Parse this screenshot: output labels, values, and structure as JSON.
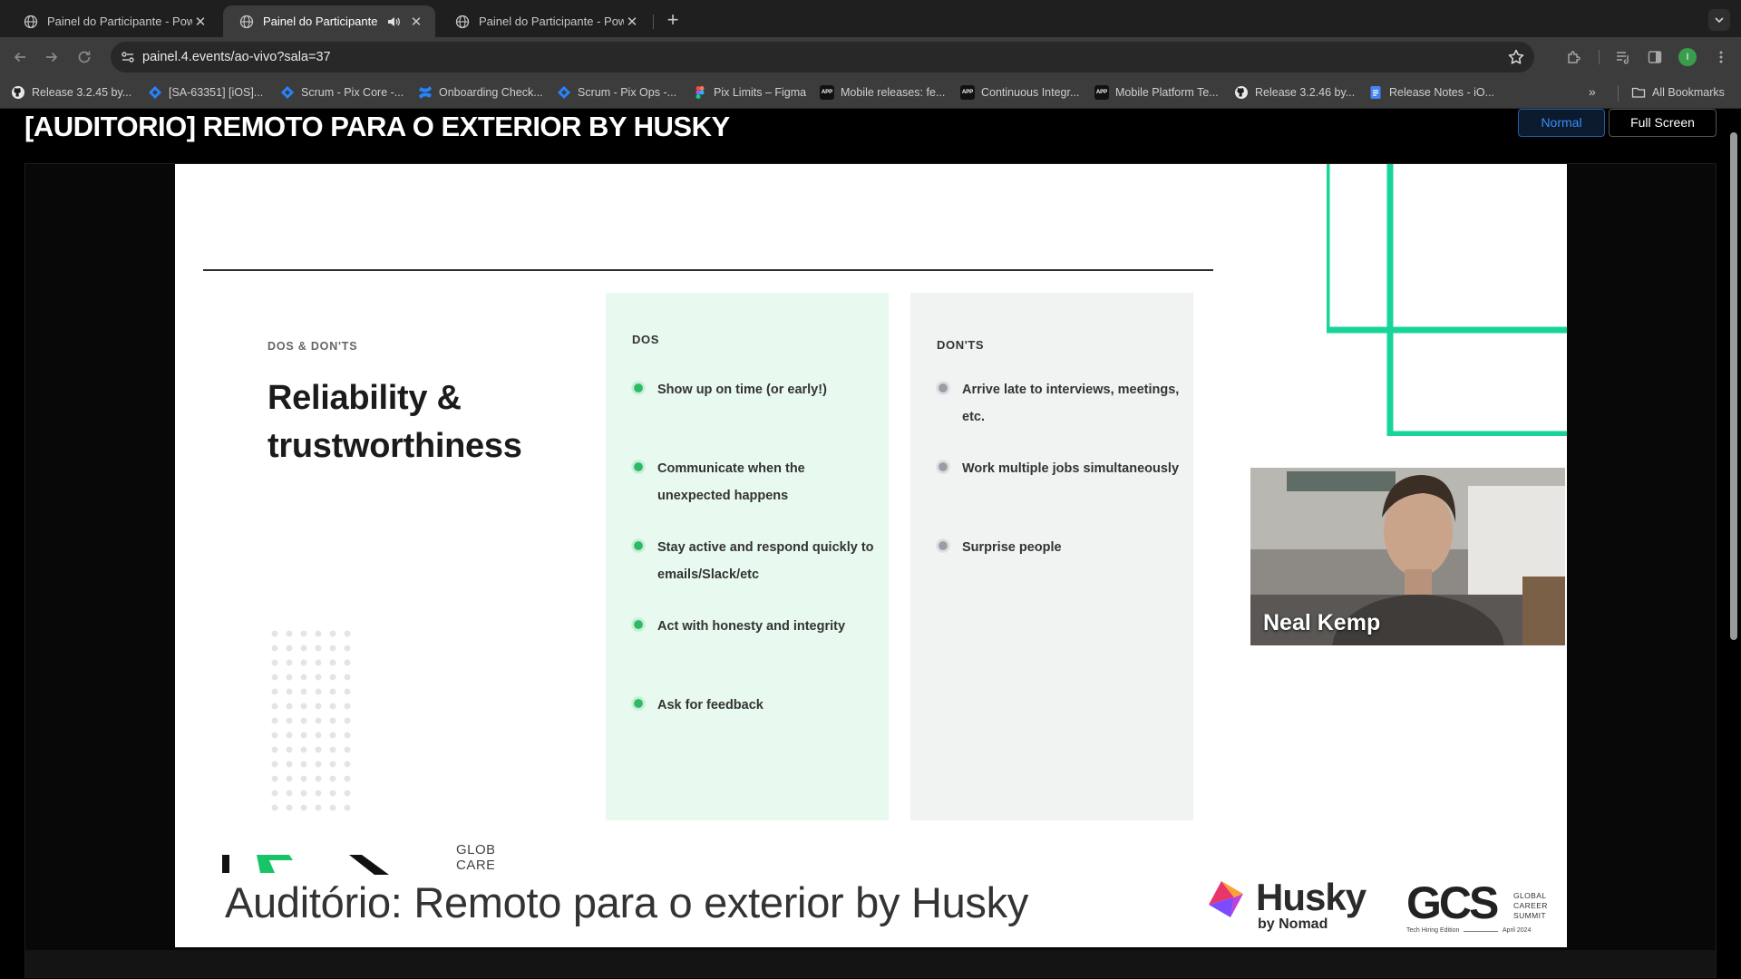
{
  "browser": {
    "tabs": [
      {
        "title": "Painel do Participante - Powe",
        "active": false,
        "audio": false
      },
      {
        "title": "Painel do Participante - Po",
        "active": true,
        "audio": true
      },
      {
        "title": "Painel do Participante - Powe",
        "active": false,
        "audio": false
      }
    ],
    "url": "painel.4.events/ao-vivo?sala=37",
    "profile_initial": "I",
    "bookmarks": [
      {
        "label": "Release 3.2.45 by...",
        "icon": "github-icon"
      },
      {
        "label": "[SA-63351] [iOS]...",
        "icon": "jira-icon"
      },
      {
        "label": "Scrum - Pix Core -...",
        "icon": "jira-icon"
      },
      {
        "label": "Onboarding Check...",
        "icon": "confluence-icon"
      },
      {
        "label": "Scrum - Pix Ops -...",
        "icon": "jira-icon"
      },
      {
        "label": "Pix Limits – Figma",
        "icon": "figma-icon"
      },
      {
        "label": "Mobile releases: fe...",
        "icon": "app-icon"
      },
      {
        "label": "Continuous Integr...",
        "icon": "app-icon"
      },
      {
        "label": "Mobile Platform Te...",
        "icon": "app-icon"
      },
      {
        "label": "Release 3.2.46 by...",
        "icon": "github-icon"
      },
      {
        "label": "Release Notes - iO...",
        "icon": "docs-icon"
      }
    ],
    "all_bookmarks_label": "All Bookmarks",
    "bookmarks_overflow": "»"
  },
  "page": {
    "room_title": "[AUDITORIO] REMOTO PARA O EXTERIOR BY HUSKY",
    "view_buttons": {
      "normal": "Normal",
      "full_screen": "Full Screen"
    }
  },
  "slide": {
    "kicker": "DOS & DON'TS",
    "heading": "Reliability & trustworthiness",
    "dos": {
      "title": "DOS",
      "items": [
        "Show up on time (or early!)",
        "Communicate when the unexpected happens",
        "Stay active and respond quickly to emails/Slack/etc",
        "Act with honesty and integrity",
        "Ask for feedback"
      ]
    },
    "donts": {
      "title": "DON'TS",
      "items": [
        "Arrive late to interviews, meetings, etc.",
        "Work multiple jobs simultaneously",
        "Surprise people"
      ]
    },
    "speaker_name": "Neal Kemp",
    "lower_third": {
      "partial_logo_text": "GLOBAL CAREER",
      "auditorium_title": "Auditório: Remoto para o exterior by Husky"
    },
    "husky_logo": {
      "word": "Husky",
      "by": "by Nomad"
    },
    "gcs_logo": {
      "letters": "GCS",
      "text": "GLOBAL CAREER SUMMIT",
      "tag": "Tech Hiring Edition",
      "date": "April 2024"
    },
    "colors": {
      "accent_green": "#18d49a",
      "dos_bg": "#e8f9ef",
      "donts_bg": "#f1f2f2",
      "normal_button": "#3a8dff"
    }
  }
}
